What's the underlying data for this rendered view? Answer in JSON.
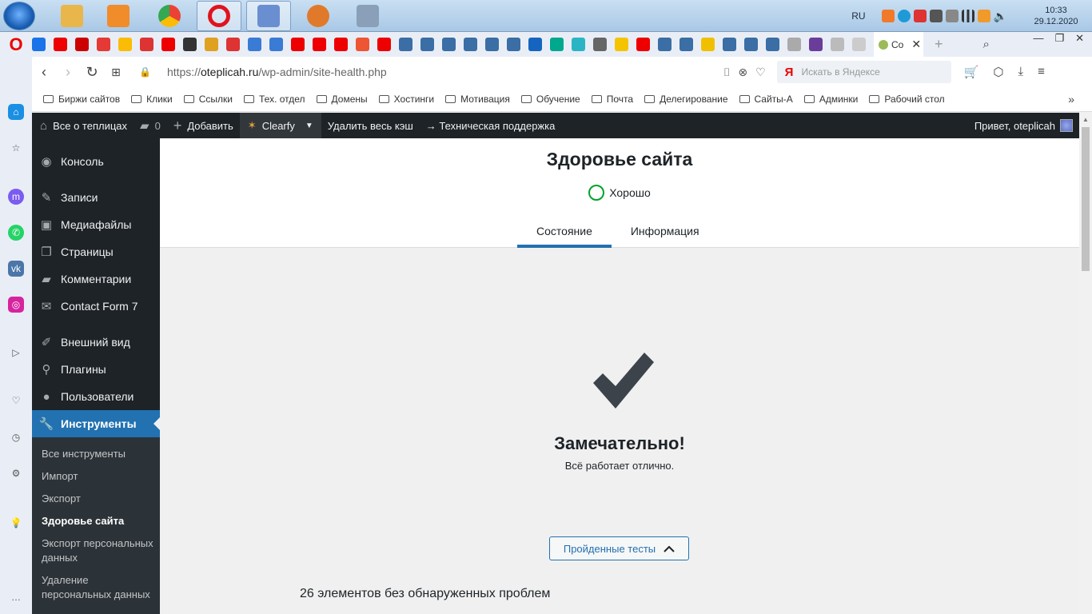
{
  "taskbar": {
    "apps": [
      {
        "name": "explorer-icon",
        "color": "#e8b64a"
      },
      {
        "name": "media-player-icon",
        "color": "#f08c2a"
      },
      {
        "name": "chrome-icon",
        "color": "#34a853"
      },
      {
        "name": "opera-icon",
        "color": "#e0141e"
      },
      {
        "name": "text-editor-icon",
        "color": "#6a8fd0"
      },
      {
        "name": "eye-app-icon",
        "color": "#e07a2a"
      },
      {
        "name": "calculator-icon",
        "color": "#8aa0b8"
      }
    ],
    "lang": "RU",
    "time": "10:33",
    "date": "29.12.2020"
  },
  "browser": {
    "logo": "O",
    "active_tab_label": "Со",
    "tab_icon_count": 42,
    "url_scheme": "https://",
    "url_host": "oteplicah.ru",
    "url_path": "/wp-admin/site-health.php",
    "search_placeholder": "Искать в Яндексе",
    "search_logo": "Я"
  },
  "bookmarks": [
    "Биржи сайтов",
    "Клики",
    "Ссылки",
    "Тех. отдел",
    "Домены",
    "Хостинги",
    "Мотивация",
    "Обучение",
    "Почта",
    "Делегирование",
    "Сайты-А",
    "Админки",
    "Рабочий стол"
  ],
  "adminbar": {
    "site_name": "Все о теплицах",
    "comments_count": "0",
    "add_new": "Добавить",
    "clearfy": "Clearfy",
    "clear_cache": "Удалить весь кэш",
    "support": "→ Техническая поддержка",
    "greeting": "Привет, oteplicah"
  },
  "menu": {
    "items": [
      {
        "label": "Консоль",
        "icon": "dashboard-icon"
      },
      {
        "label": "Записи",
        "icon": "pin-icon"
      },
      {
        "label": "Медиафайлы",
        "icon": "media-icon"
      },
      {
        "label": "Страницы",
        "icon": "pages-icon"
      },
      {
        "label": "Комментарии",
        "icon": "comments-icon"
      },
      {
        "label": "Contact Form 7",
        "icon": "mail-icon"
      },
      {
        "label": "Внешний вид",
        "icon": "brush-icon"
      },
      {
        "label": "Плагины",
        "icon": "plugin-icon"
      },
      {
        "label": "Пользователи",
        "icon": "users-icon"
      },
      {
        "label": "Инструменты",
        "icon": "wrench-icon"
      }
    ],
    "submenu": [
      "Все инструменты",
      "Импорт",
      "Экспорт",
      "Здоровье сайта",
      "Экспорт персональных данных",
      "Удаление персональных данных"
    ]
  },
  "content": {
    "title": "Здоровье сайта",
    "status": "Хорошо",
    "tabs": [
      "Состояние",
      "Информация"
    ],
    "great_title": "Замечательно!",
    "great_sub": "Всё работает отлично.",
    "passed_button": "Пройденные тесты",
    "passed_count": "26 элементов без обнаруженных проблем"
  },
  "colors": {
    "wp_dark": "#1d2327",
    "wp_blue": "#2271b1",
    "status_good": "#00a32a"
  }
}
